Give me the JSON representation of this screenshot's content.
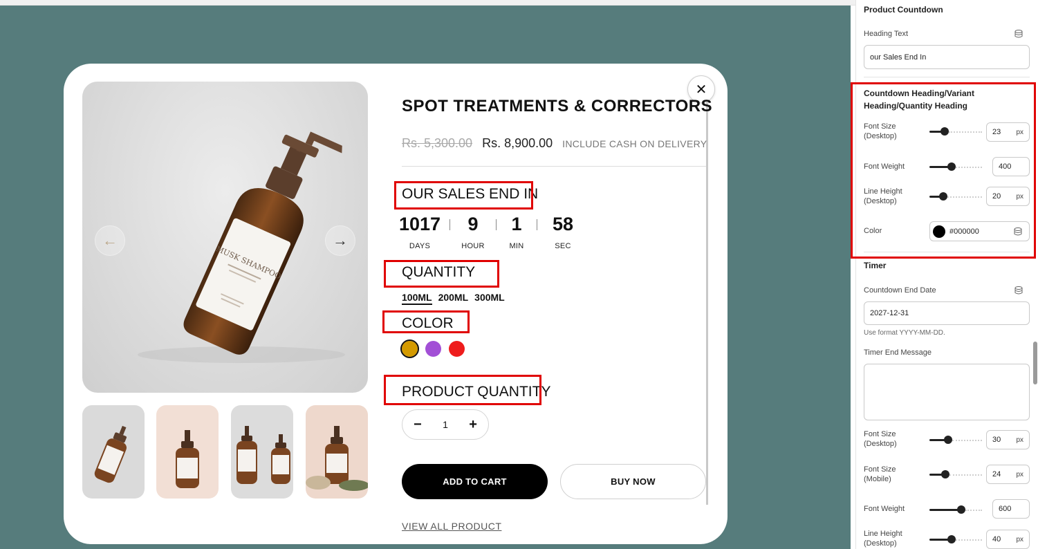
{
  "product": {
    "title": "SPOT TREATMENTS & CORRECTORS",
    "old_price": "Rs. 5,300.00",
    "new_price": "Rs. 8,900.00",
    "cod_note": "INCLUDE CASH ON DELIVERY",
    "countdown_heading": "OUR SALES END IN",
    "countdown": [
      {
        "value": "1017",
        "label": "DAYS"
      },
      {
        "value": "9",
        "label": "HOUR"
      },
      {
        "value": "1",
        "label": "MIN"
      },
      {
        "value": "58",
        "label": "SEC"
      }
    ],
    "quantity_heading": "QUANTITY",
    "sizes": [
      "100ML",
      "200ML",
      "300ML"
    ],
    "selected_size": "100ML",
    "color_heading": "COLOR",
    "colors": [
      "#d49a00",
      "#a24fd6",
      "#ee1c1c"
    ],
    "product_quantity_heading": "PRODUCT QUANTITY",
    "quantity_value": "1",
    "minus_icon": "−",
    "plus_icon": "+",
    "add_to_cart": "ADD TO CART",
    "buy_now": "BUY NOW",
    "view_all": "VIEW ALL PRODUCT",
    "bottle_label": "MUSK SHAMPOO",
    "close_icon": "✕",
    "prev_icon": "←",
    "next_icon": "→"
  },
  "settings": {
    "section_title": "Product Countdown",
    "heading_text_label": "Heading Text",
    "heading_text_value": "our Sales End In",
    "group_title": "Countdown Heading/Variant Heading/Quantity Heading",
    "font_size_label_1": "Font Size",
    "font_size_label_2": "(Desktop)",
    "font_size_value": "23",
    "font_size_level": 0.25,
    "font_weight_label": "Font Weight",
    "font_weight_value": "400",
    "font_weight_level": 0.4,
    "line_height_label_1": "Line Height",
    "line_height_label_2": "(Desktop)",
    "line_height_value": "20",
    "line_height_level": 0.22,
    "color_label": "Color",
    "color_value": "#000000",
    "unit": "px",
    "timer_title": "Timer",
    "end_date_label": "Countdown End Date",
    "end_date_value": "2027-12-31",
    "end_date_hint": "Use format YYYY-MM-DD.",
    "end_message_label": "Timer End Message",
    "end_message_value": "",
    "timer_font_size_desktop_label_1": "Font Size",
    "timer_font_size_desktop_label_2": "(Desktop)",
    "timer_font_size_desktop_value": "30",
    "timer_font_size_desktop_level": 0.33,
    "timer_font_size_mobile_label_1": "Font Size",
    "timer_font_size_mobile_label_2": "(Mobile)",
    "timer_font_size_mobile_value": "24",
    "timer_font_size_mobile_level": 0.27,
    "timer_font_weight_label": "Font Weight",
    "timer_font_weight_value": "600",
    "timer_font_weight_level": 0.62,
    "timer_line_height_label_1": "Line Height",
    "timer_line_height_label_2": "(Desktop)",
    "timer_line_height_value": "40",
    "timer_line_height_level": 0.4
  }
}
